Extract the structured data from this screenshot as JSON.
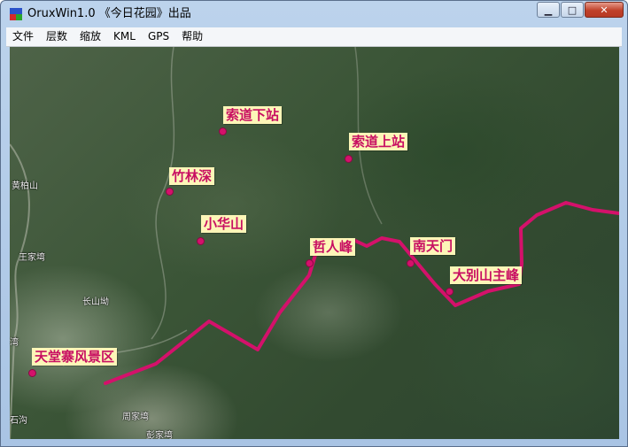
{
  "window": {
    "title": "OruxWin1.0 《今日花园》出品",
    "minimize_glyph": "▁",
    "maximize_glyph": "□",
    "close_glyph": "✕"
  },
  "menu": [
    "文件",
    "层数",
    "缩放",
    "KML",
    "GPS",
    "帮助"
  ],
  "map": {
    "place_names": [
      "黄柏山",
      "王家塆",
      "长山坳",
      "石沟",
      "周家塆",
      "彭家塆",
      "湾"
    ],
    "pois": [
      "索道下站",
      "索道上站",
      "竹林深",
      "小华山",
      "哲人峰",
      "南天门",
      "大别山主峰",
      "天堂寨风景区"
    ],
    "track_color": "#d4116b"
  }
}
